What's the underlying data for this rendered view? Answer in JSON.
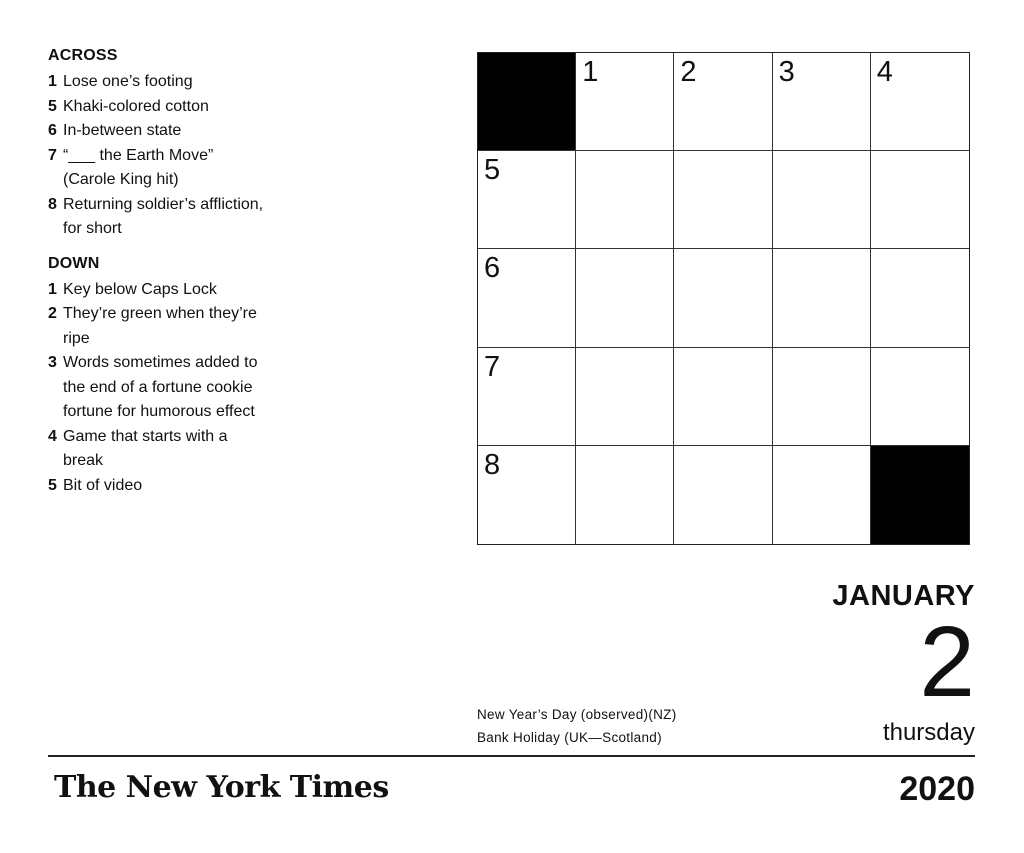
{
  "clues": {
    "across_heading": "ACROSS",
    "across": [
      {
        "num": "1",
        "text": "Lose one’s footing"
      },
      {
        "num": "5",
        "text": "Khaki-colored cotton"
      },
      {
        "num": "6",
        "text": "In-between state"
      },
      {
        "num": "7",
        "text": "“___ the Earth Move” (Carole King hit)"
      },
      {
        "num": "8",
        "text": "Returning soldier’s affliction, for short"
      }
    ],
    "down_heading": "DOWN",
    "down": [
      {
        "num": "1",
        "text": "Key below Caps Lock"
      },
      {
        "num": "2",
        "text": "They’re green when they’re ripe"
      },
      {
        "num": "3",
        "text": "Words sometimes added to the end of a fortune cookie fortune for humorous effect"
      },
      {
        "num": "4",
        "text": "Game that starts with a break"
      },
      {
        "num": "5",
        "text": "Bit of video"
      }
    ]
  },
  "grid": {
    "rows": 5,
    "cols": 5,
    "black_cells": [
      [
        0,
        0
      ],
      [
        4,
        4
      ]
    ],
    "numbers": [
      {
        "row": 0,
        "col": 1,
        "num": "1"
      },
      {
        "row": 0,
        "col": 2,
        "num": "2"
      },
      {
        "row": 0,
        "col": 3,
        "num": "3"
      },
      {
        "row": 0,
        "col": 4,
        "num": "4"
      },
      {
        "row": 1,
        "col": 0,
        "num": "5"
      },
      {
        "row": 2,
        "col": 0,
        "num": "6"
      },
      {
        "row": 3,
        "col": 0,
        "num": "7"
      },
      {
        "row": 4,
        "col": 0,
        "num": "8"
      }
    ]
  },
  "date": {
    "month": "JANUARY",
    "day": "2",
    "weekday": "thursday",
    "year": "2020"
  },
  "holidays": [
    "New Year’s Day (observed)(NZ)",
    "Bank Holiday (UK—Scotland)"
  ],
  "brand": {
    "logo_text": "The New York Times"
  }
}
